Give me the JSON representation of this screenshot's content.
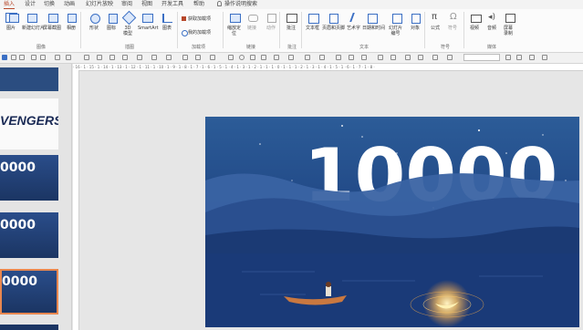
{
  "ribbon_tabs": [
    "插入",
    "设计",
    "切换",
    "动画",
    "幻灯片放映",
    "审阅",
    "视图",
    "开发工具",
    "帮助",
    "操作说明搜索"
  ],
  "active_tab": "插入",
  "buttons": {
    "new_slide": "新建幻灯片",
    "image": "图片",
    "screenshot": "屏幕截图",
    "album": "相册",
    "shape": "形状",
    "icon": "图标",
    "model3d": "3D\n模型",
    "smartart": "SmartArt",
    "chart": "图表",
    "get_addin": "获取加载项",
    "my_addin": "我的加载项",
    "zoom": "缩放定\n位",
    "link": "链接",
    "action": "动作",
    "comment": "批注",
    "textbox": "文本框",
    "header_footer": "页眉和页脚",
    "wordart": "艺术字",
    "datetime": "日期和时间",
    "slide_number": "幻灯片\n编号",
    "object": "对象",
    "equation": "公式",
    "symbol": "符号",
    "video": "视频",
    "audio": "音频",
    "screen_record": "屏幕\n录制"
  },
  "groups": [
    "图像",
    "插图",
    "加载项",
    "链接",
    "批注",
    "文本",
    "符号",
    "媒体"
  ],
  "ruler_text": "· 16 · 1 · 15 · 1 · 14 · 1 · 13 · 1 · 12 · 1 · 11 · 1 · 10 · 1 · 9 · 1 · 8 · 1 · 7 · 1 · 6 · 1 · 5 · 1 · 4 · 1 · 3 · 1 · 2 · 1 · 1 · 1 · 0 · 1 · 1 · 1 · 2 · 1 · 3 · 1 · 4 · 1 · 5 · 1 · 6 · 1 · 7 · 1 · 8 ·",
  "slide": {
    "big_number": "10000"
  },
  "thumbnails": {
    "avengers": "VENGERS",
    "num": "0000"
  },
  "colors": {
    "accent": "#b7472a",
    "slide_sky": "#1d3e78",
    "moon": "#ffd27a"
  }
}
